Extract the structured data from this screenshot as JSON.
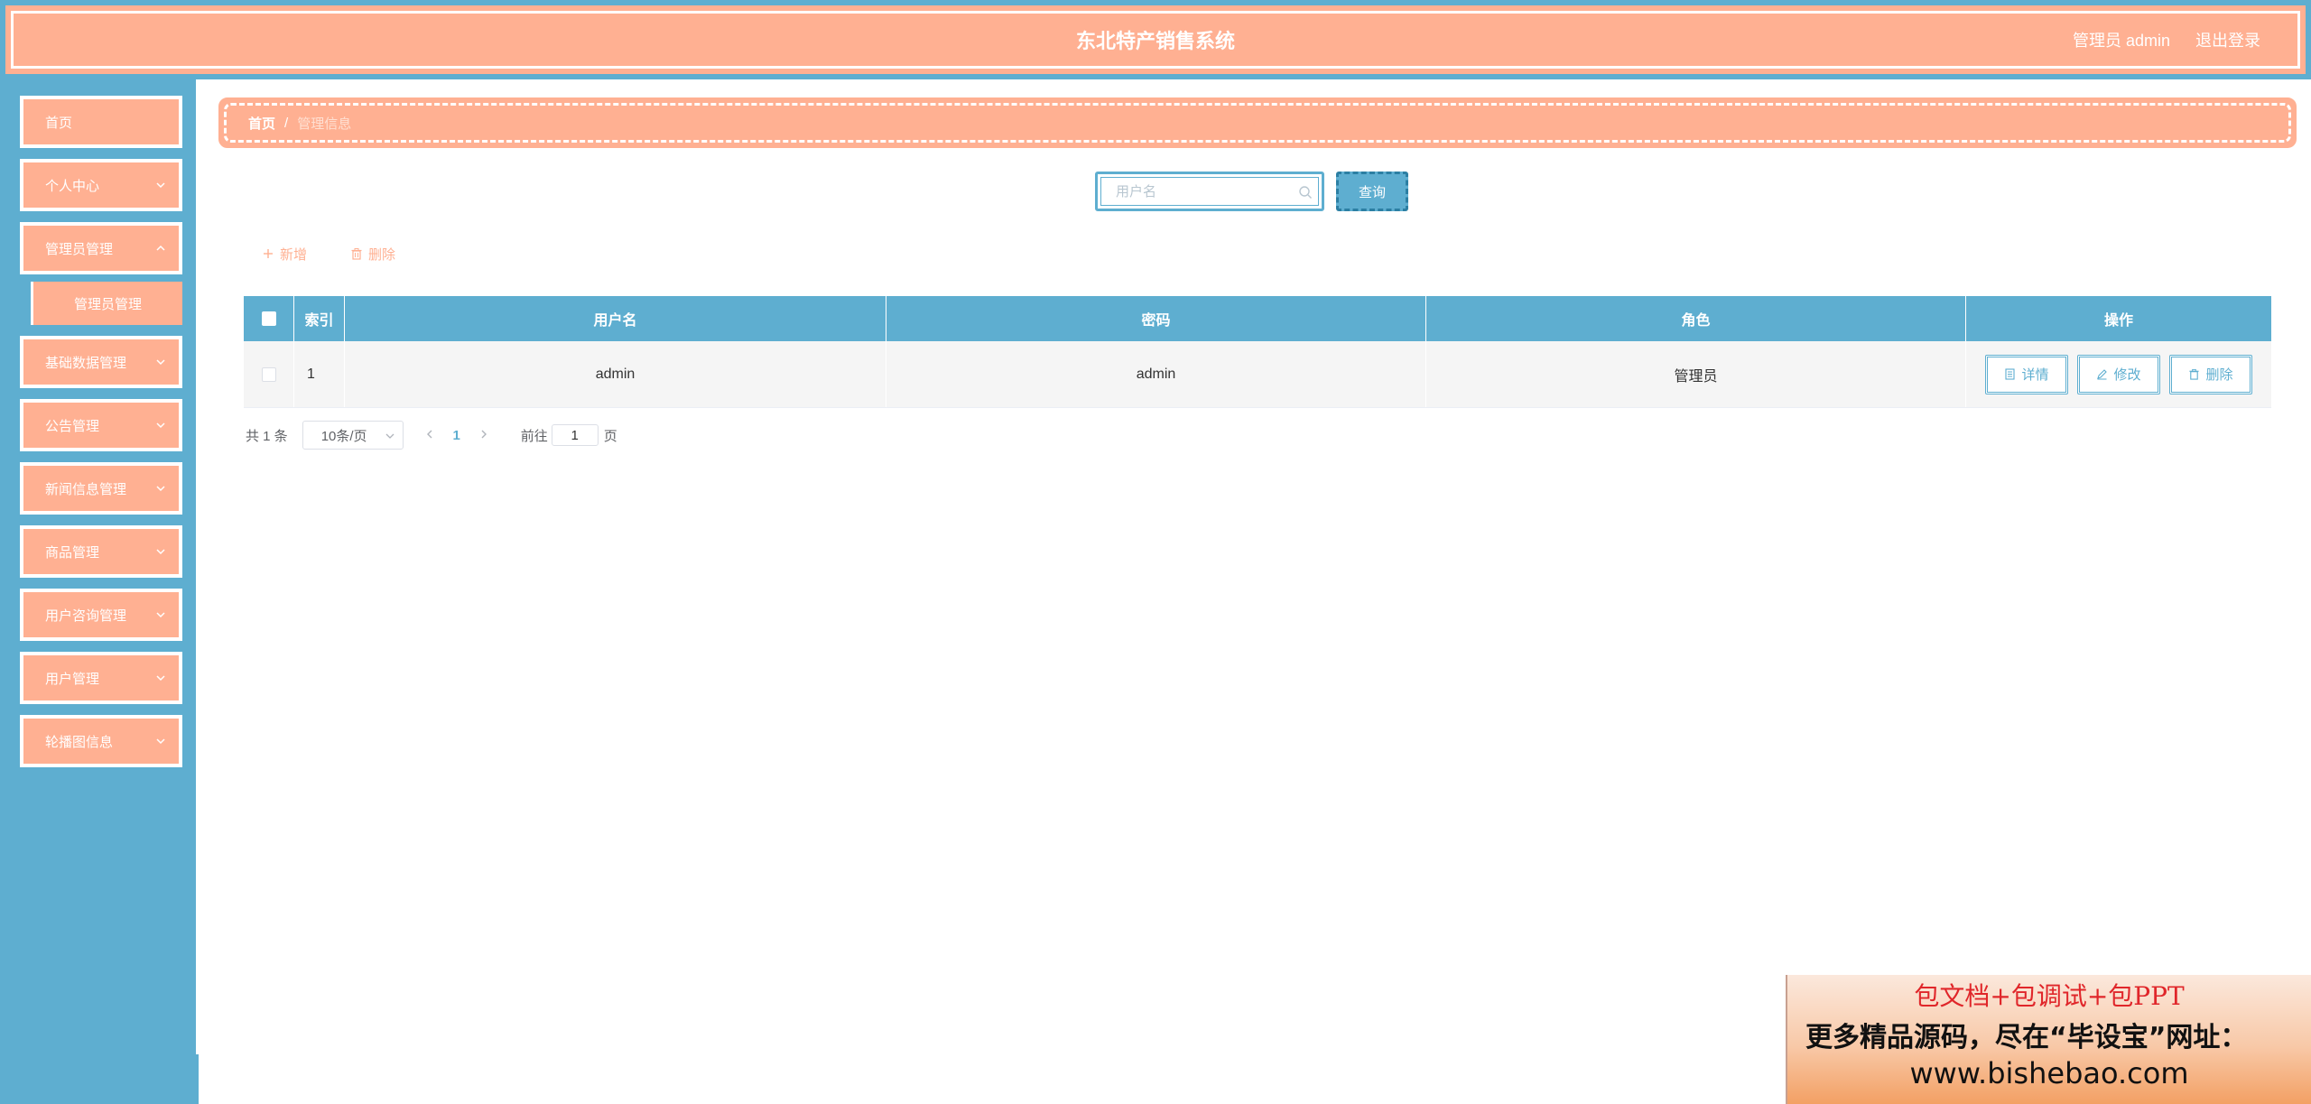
{
  "header": {
    "title": "东北特产销售系统",
    "user_label": "管理员 admin",
    "logout_label": "退出登录"
  },
  "sidebar": {
    "items": [
      {
        "label": "首页",
        "has_children": false
      },
      {
        "label": "个人中心",
        "has_children": true
      },
      {
        "label": "管理员管理",
        "has_children": true
      },
      {
        "label": "基础数据管理",
        "has_children": true
      },
      {
        "label": "公告管理",
        "has_children": true
      },
      {
        "label": "新闻信息管理",
        "has_children": true
      },
      {
        "label": "商品管理",
        "has_children": true
      },
      {
        "label": "用户咨询管理",
        "has_children": true
      },
      {
        "label": "用户管理",
        "has_children": true
      },
      {
        "label": "轮播图信息",
        "has_children": true
      }
    ],
    "submenu": {
      "label": "管理员管理"
    }
  },
  "breadcrumb": {
    "home": "首页",
    "separator": "/",
    "current": "管理信息"
  },
  "search": {
    "placeholder": "用户名",
    "value": "",
    "button_label": "查询"
  },
  "actions": {
    "add_label": "新增",
    "delete_label": "删除"
  },
  "table": {
    "columns": [
      "索引",
      "用户名",
      "密码",
      "角色",
      "操作"
    ],
    "rows": [
      {
        "index": "1",
        "username": "admin",
        "password": "admin",
        "role": "管理员"
      }
    ],
    "row_actions": {
      "detail": "详情",
      "edit": "修改",
      "delete": "删除"
    }
  },
  "pagination": {
    "total_text": "共 1 条",
    "page_size": "10条/页",
    "current_page": "1",
    "goto_label": "前往",
    "goto_value": "1",
    "page_suffix": "页"
  },
  "promo": {
    "line1": "包文档+包调试+包PPT",
    "line2": "更多精品源码，尽在“毕设宝”网址：",
    "line3": "www.bishebao.com"
  },
  "colors": {
    "primary": "#5eaed0",
    "accent": "#ffb092"
  }
}
